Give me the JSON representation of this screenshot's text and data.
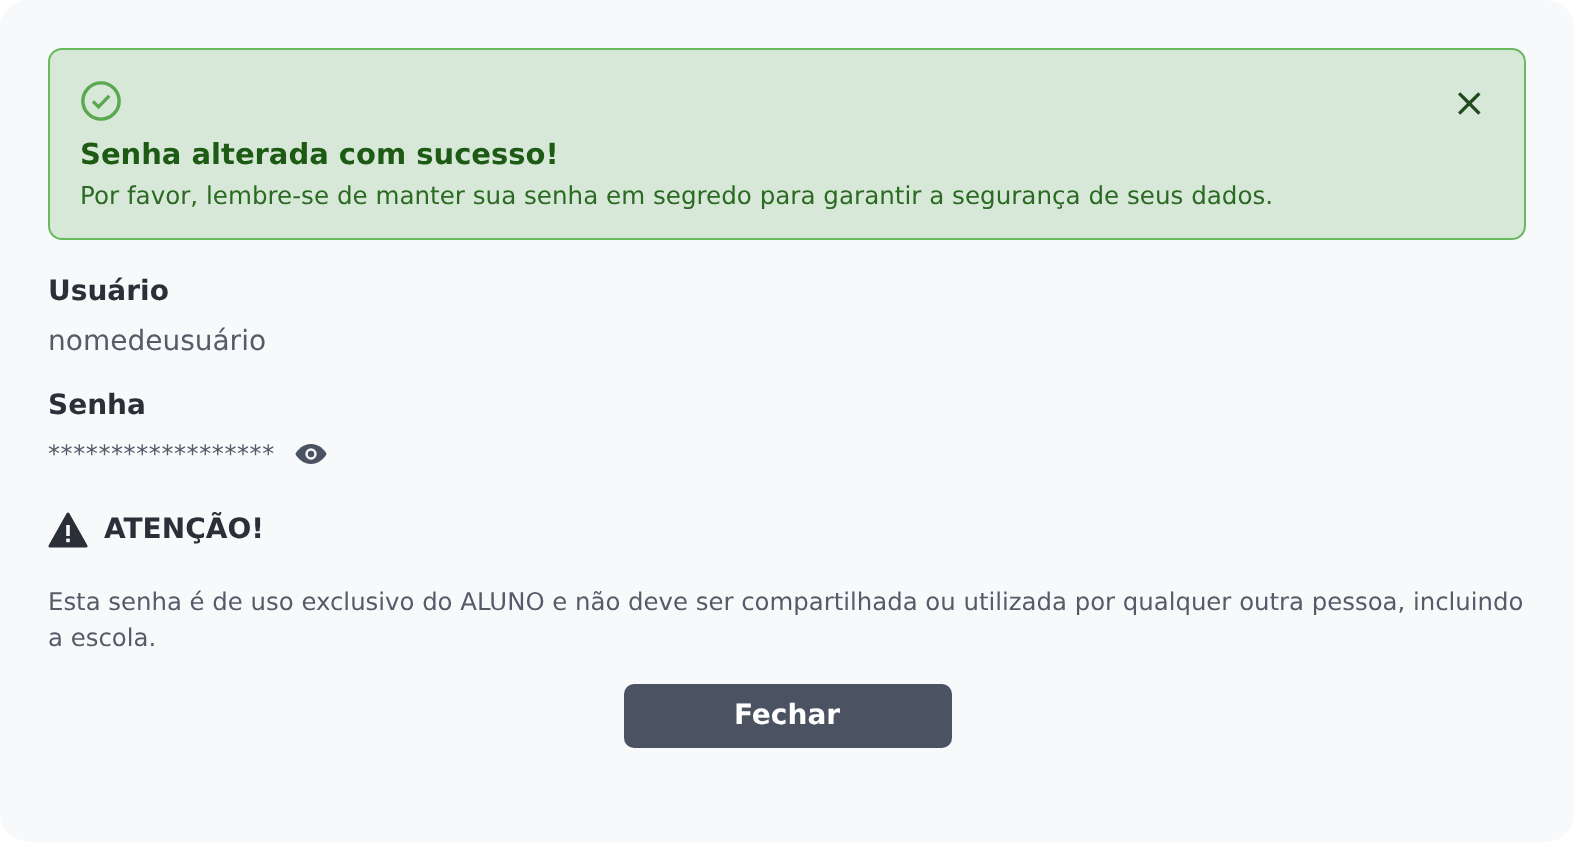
{
  "alert": {
    "title": "Senha alterada com sucesso!",
    "message": "Por favor, lembre-se de manter sua senha em segredo para garantir a segurança de seus dados.",
    "close_label": "×"
  },
  "fields": [
    {
      "label": "Usuário",
      "value": "nomedeusuário",
      "kind": "text"
    },
    {
      "label": "Senha",
      "value": "******************",
      "kind": "password"
    }
  ],
  "warning": {
    "title": "ATENÇÃO!",
    "message": "Esta senha é de uso exclusivo do ALUNO e não deve ser compartilhada ou utilizada por qualquer outra pessoa, incluindo a escola."
  },
  "buttons": [
    "Fechar"
  ]
}
